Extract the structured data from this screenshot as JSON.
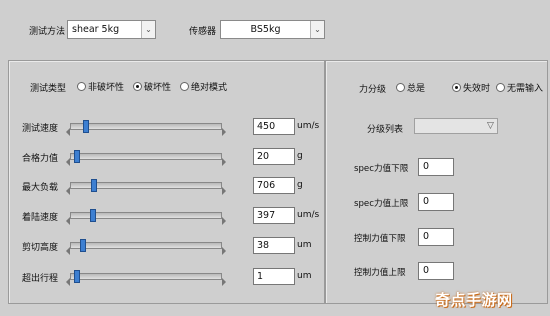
{
  "header": {
    "test_method_label": "测试方法",
    "test_method_value": "shear 5kg",
    "sensor_label": "传感器",
    "sensor_value": "BS5kg"
  },
  "left_panel": {
    "test_type_label": "测试类型",
    "test_type_options": [
      {
        "label": "非破坏性",
        "selected": false
      },
      {
        "label": "破坏性",
        "selected": true
      },
      {
        "label": "绝对模式",
        "selected": false
      }
    ],
    "params": [
      {
        "name": "测试速度",
        "value": "450",
        "unit": "um/s",
        "level": 0.08
      },
      {
        "name": "合格力值",
        "value": "20",
        "unit": "g",
        "level": 0.02
      },
      {
        "name": "最大负载",
        "value": "706",
        "unit": "g",
        "level": 0.14
      },
      {
        "name": "着陆速度",
        "value": "397",
        "unit": "um/s",
        "level": 0.13
      },
      {
        "name": "剪切高度",
        "value": "38",
        "unit": "um",
        "level": 0.06
      },
      {
        "name": "超出行程",
        "value": "1",
        "unit": "um",
        "level": 0.02
      }
    ]
  },
  "right_panel": {
    "grading_label": "力分级",
    "grading_options": [
      {
        "label": "总是",
        "selected": false
      },
      {
        "label": "失效时",
        "selected": true
      },
      {
        "label": "无需输入",
        "selected": false
      }
    ],
    "grade_list_label": "分级列表",
    "grade_list_value": "",
    "limits": [
      {
        "label": "spec力值下限",
        "value": "0"
      },
      {
        "label": "spec力值上限",
        "value": "0"
      },
      {
        "label": "控制力值下限",
        "value": "0"
      },
      {
        "label": "控制力值上限",
        "value": "0"
      }
    ]
  },
  "watermark": "奇点手游网"
}
